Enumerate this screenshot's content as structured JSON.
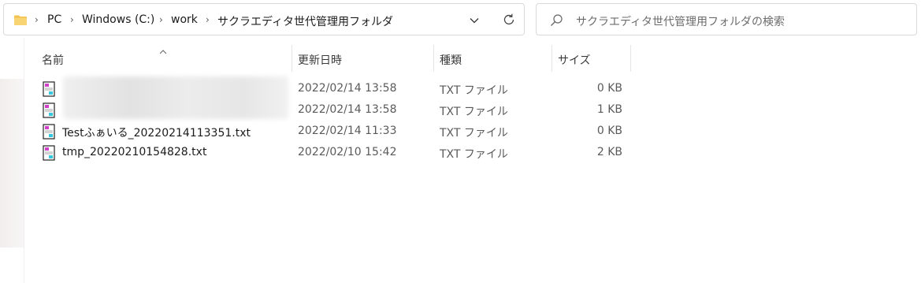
{
  "address_bar": {
    "breadcrumbs": [
      "PC",
      "Windows (C:)",
      "work",
      "サクラエディタ世代管理用フォルダ"
    ],
    "icons": [
      "folder-icon",
      "chevron-right-icon",
      "chevron-down-icon",
      "refresh-icon"
    ]
  },
  "search": {
    "placeholder": "サクラエディタ世代管理用フォルダの検索",
    "icon": "search-icon"
  },
  "columns": {
    "name": "名前",
    "date": "更新日時",
    "type": "種類",
    "size": "サイズ"
  },
  "files": [
    {
      "name": "",
      "date": "2022/02/14 13:58",
      "type": "TXT ファイル",
      "size": "0 KB",
      "icon": "text-file-icon"
    },
    {
      "name": "",
      "date": "2022/02/14 13:58",
      "type": "TXT ファイル",
      "size": "1 KB",
      "icon": "text-file-icon"
    },
    {
      "name": "Testふぁいる_20220214113351.txt",
      "date": "2022/02/14 11:33",
      "type": "TXT ファイル",
      "size": "0 KB",
      "icon": "text-file-icon"
    },
    {
      "name": "tmp_20220210154828.txt",
      "date": "2022/02/10 15:42",
      "type": "TXT ファイル",
      "size": "2 KB",
      "icon": "text-file-icon"
    }
  ],
  "colors": {
    "folder": "#f2c14e",
    "icon_magenta": "#d040c8",
    "icon_cyan": "#35c6e0",
    "border": "#d9d9d9"
  }
}
